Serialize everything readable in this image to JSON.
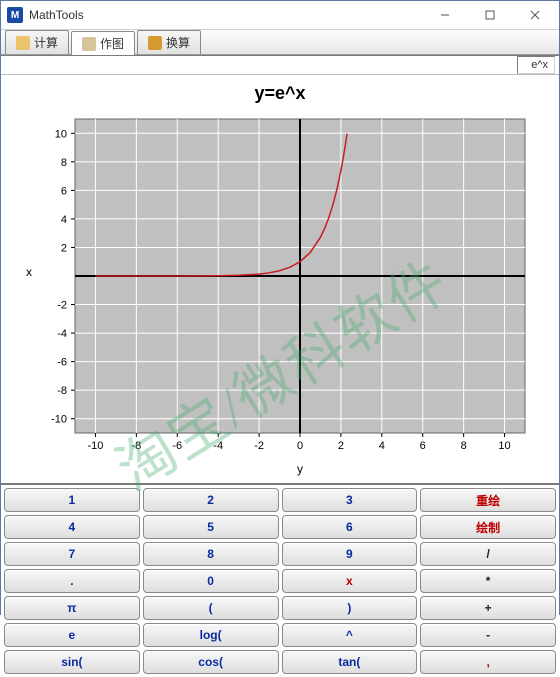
{
  "window": {
    "title": "MathTools",
    "app_icon": "M"
  },
  "tabs": [
    {
      "label": "计算",
      "icon_bg": "#e9c46a"
    },
    {
      "label": "作图",
      "icon_bg": "#d6c49a",
      "active": true
    },
    {
      "label": "换算",
      "icon_bg": "#d49a2e"
    }
  ],
  "formula_bar": "e^x",
  "watermark": "淘宝/微科软件",
  "chart_data": {
    "type": "line",
    "title": "y=e^x",
    "xlabel": "y",
    "ylabel": "x",
    "xlim": [
      -11,
      11
    ],
    "ylim": [
      -11,
      11
    ],
    "xticks": [
      -10,
      -8,
      -6,
      -4,
      -2,
      0,
      2,
      4,
      6,
      8,
      10
    ],
    "yticks": [
      -10,
      -8,
      -6,
      -4,
      -2,
      2,
      4,
      6,
      8,
      10
    ],
    "series": [
      {
        "name": "e^x",
        "color": "#c81e1e",
        "x": [
          -10,
          -8,
          -6,
          -4,
          -3,
          -2,
          -1.5,
          -1,
          -0.5,
          0,
          0.5,
          1,
          1.2,
          1.4,
          1.6,
          1.8,
          2,
          2.1,
          2.2,
          2.3
        ],
        "y": [
          0,
          0,
          0.002,
          0.018,
          0.05,
          0.135,
          0.223,
          0.368,
          0.607,
          1,
          1.649,
          2.718,
          3.32,
          4.055,
          4.953,
          6.05,
          7.389,
          8.166,
          9.025,
          9.974
        ]
      }
    ]
  },
  "keypad": [
    {
      "label": "1",
      "cls": "blue"
    },
    {
      "label": "2",
      "cls": "blue"
    },
    {
      "label": "3",
      "cls": "blue"
    },
    {
      "label": "重绘",
      "cls": "red"
    },
    {
      "label": "4",
      "cls": "blue"
    },
    {
      "label": "5",
      "cls": "blue"
    },
    {
      "label": "6",
      "cls": "blue"
    },
    {
      "label": "绘制",
      "cls": "red"
    },
    {
      "label": "7",
      "cls": "blue"
    },
    {
      "label": "8",
      "cls": "blue"
    },
    {
      "label": "9",
      "cls": "blue"
    },
    {
      "label": "/",
      "cls": "black"
    },
    {
      "label": ".",
      "cls": "blue"
    },
    {
      "label": "0",
      "cls": "blue"
    },
    {
      "label": "x",
      "cls": "redtxt"
    },
    {
      "label": "*",
      "cls": "black"
    },
    {
      "label": "π",
      "cls": "blue"
    },
    {
      "label": "(",
      "cls": "blue"
    },
    {
      "label": ")",
      "cls": "blue"
    },
    {
      "label": "+",
      "cls": "black"
    },
    {
      "label": "e",
      "cls": "blue"
    },
    {
      "label": "log(",
      "cls": "blue"
    },
    {
      "label": "^",
      "cls": "blue"
    },
    {
      "label": "-",
      "cls": "black"
    },
    {
      "label": "sin(",
      "cls": "blue"
    },
    {
      "label": "cos(",
      "cls": "blue"
    },
    {
      "label": "tan(",
      "cls": "blue"
    },
    {
      "label": ",",
      "cls": "redtxt"
    }
  ]
}
